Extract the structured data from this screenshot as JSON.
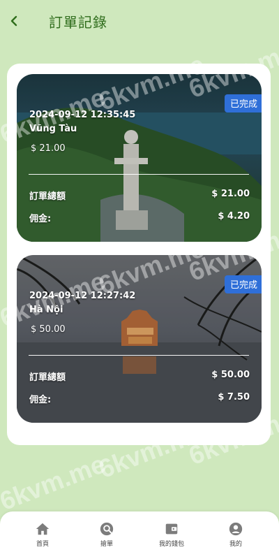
{
  "header": {
    "title": "訂單記錄",
    "back_icon": "chevron-left-icon"
  },
  "orders": [
    {
      "status": "已完成",
      "time": "2024-09-12 12:35:45",
      "place": "Vũng Tàu",
      "price": "$ 21.00",
      "total_label": "訂單總額",
      "total_value": "$ 21.00",
      "commission_label": "佣金:",
      "commission_value": "$ 4.20",
      "image": "Vũng Tàu Christ statue on green hillside above the sea"
    },
    {
      "status": "已完成",
      "time": "2024-09-12 12:27:42",
      "place": "Hà Nội",
      "price": "$ 50.00",
      "total_label": "訂單總額",
      "total_value": "$ 50.00",
      "commission_label": "佣金:",
      "commission_value": "$ 7.50",
      "image": "Hanoi Turtle Tower illuminated on a lake at dusk with tree silhouettes"
    }
  ],
  "nav": [
    {
      "label": "首頁",
      "icon": "home-icon"
    },
    {
      "label": "搶單",
      "icon": "search-grab-icon"
    },
    {
      "label": "我的錢包",
      "icon": "wallet-icon"
    },
    {
      "label": "我的",
      "icon": "user-icon"
    }
  ],
  "watermark": "6kvm.me",
  "colors": {
    "background": "#cfe8bd",
    "title": "#2f6d1c",
    "badge": "#2f6fd8",
    "panel": "#ffffff"
  }
}
